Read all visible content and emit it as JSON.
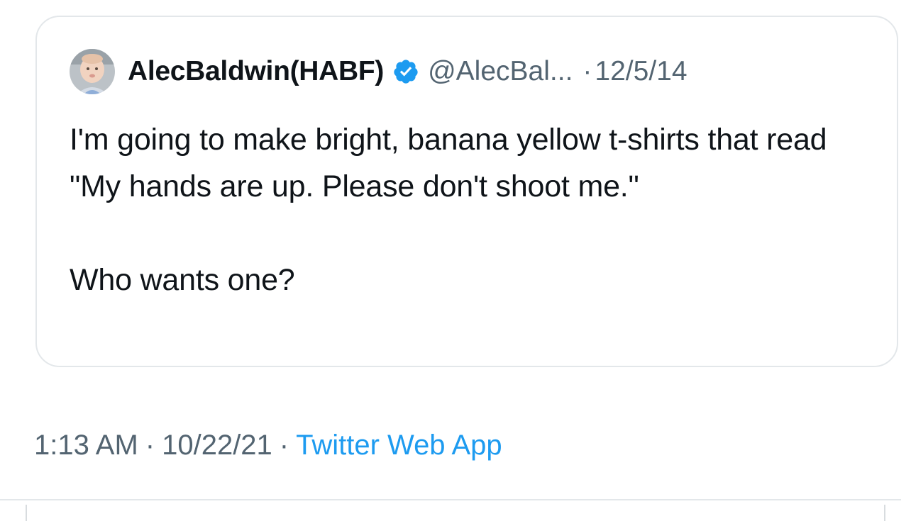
{
  "quoted_tweet": {
    "display_name": "AlecBaldwin(HABF)",
    "handle": "@AlecBal...",
    "separator": "·",
    "date": "12/5/14",
    "verified_icon": "verified-badge-icon",
    "avatar_icon": "baby-avatar",
    "text_line_1": "I'm going to make bright, banana yellow t-shirts that read \"My hands are up. Please don't shoot me.\"",
    "text_line_2": "Who wants one?"
  },
  "tweet_meta": {
    "time": "1:13 AM",
    "separator_1": "·",
    "date": "10/22/21",
    "separator_2": "·",
    "source": "Twitter Web App"
  },
  "colors": {
    "verified_blue": "#1d9bf0",
    "link_blue": "#1d9bf0",
    "secondary_text": "#536471",
    "border": "#e3e7ea"
  }
}
